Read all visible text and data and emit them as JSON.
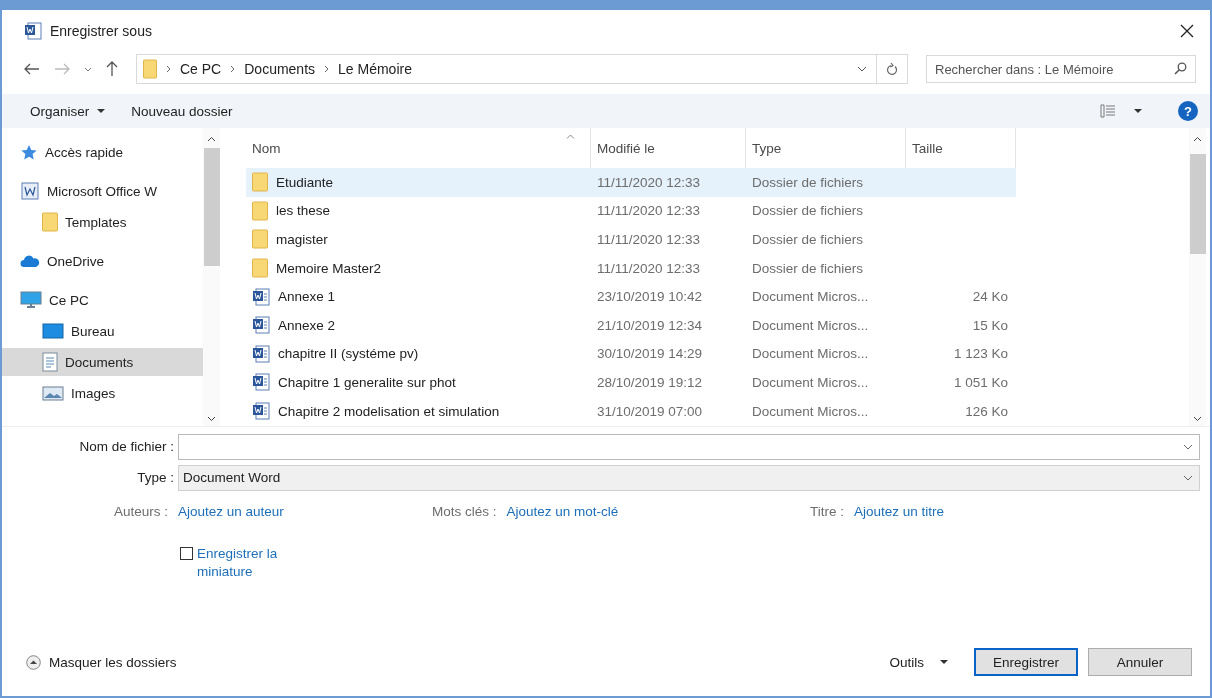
{
  "window": {
    "title": "Enregistrer sous"
  },
  "address": {
    "path": [
      "Ce PC",
      "Documents",
      "Le Mémoire"
    ]
  },
  "search": {
    "placeholder": "Rechercher dans : Le Mémoire"
  },
  "toolbar": {
    "organize": "Organiser",
    "new_folder": "Nouveau dossier",
    "help": "?"
  },
  "sidebar": {
    "items": [
      {
        "label": "Accès rapide",
        "kind": "star",
        "selected": false
      },
      {
        "label": "Microsoft Office W",
        "kind": "office",
        "selected": false,
        "children": [
          {
            "label": "Templates",
            "kind": "folder",
            "selected": false
          }
        ]
      },
      {
        "label": "OneDrive",
        "kind": "cloud",
        "selected": false
      },
      {
        "label": "Ce PC",
        "kind": "pc",
        "selected": false,
        "children": [
          {
            "label": "Bureau",
            "kind": "desktop",
            "selected": false
          },
          {
            "label": "Documents",
            "kind": "documents",
            "selected": true
          },
          {
            "label": "Images",
            "kind": "images",
            "selected": false
          }
        ]
      }
    ]
  },
  "table": {
    "columns": [
      "Nom",
      "Modifié le",
      "Type",
      "Taille"
    ],
    "rows": [
      {
        "kind": "folder",
        "name": "Etudiante",
        "modified": "11/11/2020 12:33",
        "type": "Dossier de fichiers",
        "selected": true
      },
      {
        "kind": "folder",
        "name": "les these",
        "modified": "11/11/2020 12:33",
        "type": "Dossier de fichiers",
        "selected": false
      },
      {
        "kind": "folder",
        "name": "magister",
        "modified": "11/11/2020 12:33",
        "type": "Dossier de fichiers",
        "selected": false
      },
      {
        "kind": "folder",
        "name": "Memoire Master2",
        "modified": "11/11/2020 12:33",
        "type": "Dossier de fichiers",
        "selected": false
      },
      {
        "kind": "word",
        "name": "Annexe 1",
        "modified": "23/10/2019 10:42",
        "type": "Document Micros...",
        "size": "24 Ko",
        "selected": false
      },
      {
        "kind": "word",
        "name": "Annexe 2",
        "modified": "21/10/2019 12:34",
        "type": "Document Micros...",
        "size": "15 Ko",
        "selected": false
      },
      {
        "kind": "word",
        "name": "chapitre  II (systéme pv)",
        "modified": "30/10/2019 14:29",
        "type": "Document Micros...",
        "size": "1 123 Ko",
        "selected": false
      },
      {
        "kind": "word",
        "name": "Chapitre 1 generalite sur phot",
        "modified": "28/10/2019 19:12",
        "type": "Document Micros...",
        "size": "1 051 Ko",
        "selected": false
      },
      {
        "kind": "word",
        "name": "Chapitre 2 modelisation et simulation",
        "modified": "31/10/2019 07:00",
        "type": "Document Micros...",
        "size": "126 Ko",
        "selected": false
      }
    ]
  },
  "form": {
    "filename": {
      "label": "Nom de fichier :"
    },
    "type": {
      "label": "Type :",
      "value": "Document Word"
    },
    "metadata": [
      {
        "label": "Auteurs :",
        "link": "Ajoutez un auteur"
      },
      {
        "label": "Mots clés :",
        "link": "Ajoutez un mot-clé"
      },
      {
        "label": "Titre :",
        "link": "Ajoutez un titre"
      }
    ],
    "thumbnail": {
      "label": "Enregistrer la miniature",
      "checked": false
    }
  },
  "footer": {
    "hide_folders": "Masquer les dossiers",
    "tools": "Outils",
    "save": "Enregistrer",
    "cancel": "Annuler"
  }
}
